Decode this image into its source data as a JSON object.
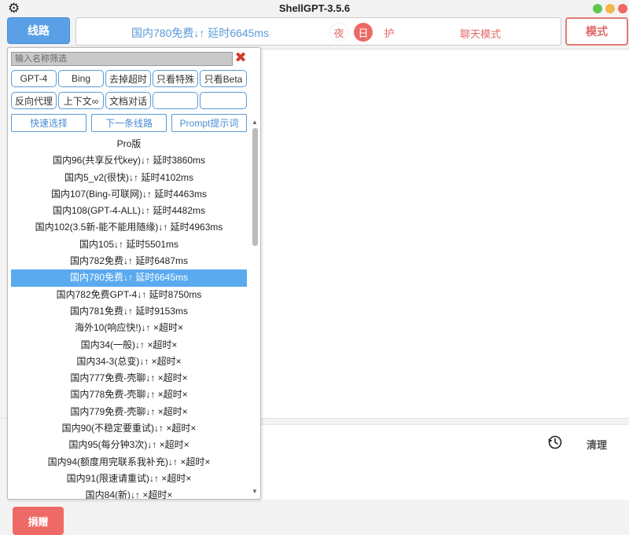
{
  "window": {
    "title": "ShellGPT-3.5.6"
  },
  "topbar": {
    "route_button": "线路",
    "current_route": "国内780免费↓↑ 延时6645ms",
    "night": "夜",
    "day": "日",
    "eye": "护",
    "chat_mode": "聊天模式",
    "mode_button": "模式"
  },
  "dropdown": {
    "filter_placeholder": "输入名称筛选",
    "close": "✖",
    "chips_row1": [
      "GPT-4",
      "Bing",
      "去掉超时",
      "只看特殊",
      "只看Beta"
    ],
    "chips_row2": [
      "反向代理",
      "上下文∞",
      "文档对话",
      "",
      ""
    ],
    "actions": [
      "快速选择",
      "下一条线路",
      "Prompt提示词"
    ],
    "selected_index": 8,
    "routes": [
      "Pro版",
      "国内96(共享反代key)↓↑ 延时3860ms",
      "国内5_v2(很快)↓↑ 延时4102ms",
      "国内107(Bing-可联网)↓↑ 延时4463ms",
      "国内108(GPT-4-ALL)↓↑ 延时4482ms",
      "国内102(3.5新-能不能用随缘)↓↑ 延时4963ms",
      "国内105↓↑ 延时5501ms",
      "国内782免费↓↑ 延时6487ms",
      "国内780免费↓↑ 延时6645ms",
      "国内782免费GPT-4↓↑ 延时8750ms",
      "国内781免费↓↑ 延时9153ms",
      "海外10(响应快!)↓↑ ×超时×",
      "国内34(一般)↓↑ ×超时×",
      "国内34-3(总变)↓↑ ×超时×",
      "国内777免费-壳聊↓↑ ×超时×",
      "国内778免费-壳聊↓↑ ×超时×",
      "国内779免费-壳聊↓↑ ×超时×",
      "国内90(不稳定要重试)↓↑ ×超时×",
      "国内95(每分钟3次)↓↑ ×超时×",
      "国内94(额度用完联系我补充)↓↑ ×超时×",
      "国内91(限速请重试)↓↑ ×超时×",
      "国内84(新)↓↑ ×超时×"
    ]
  },
  "bottom": {
    "clear": "清理",
    "donate": "捐赠"
  },
  "icons": {
    "gear": "gear-icon",
    "history": "history-icon",
    "close": "close-icon"
  },
  "colors": {
    "accent_blue": "#5aa0e6",
    "accent_red": "#ee6a66",
    "selected_row": "#5aaaf0"
  }
}
